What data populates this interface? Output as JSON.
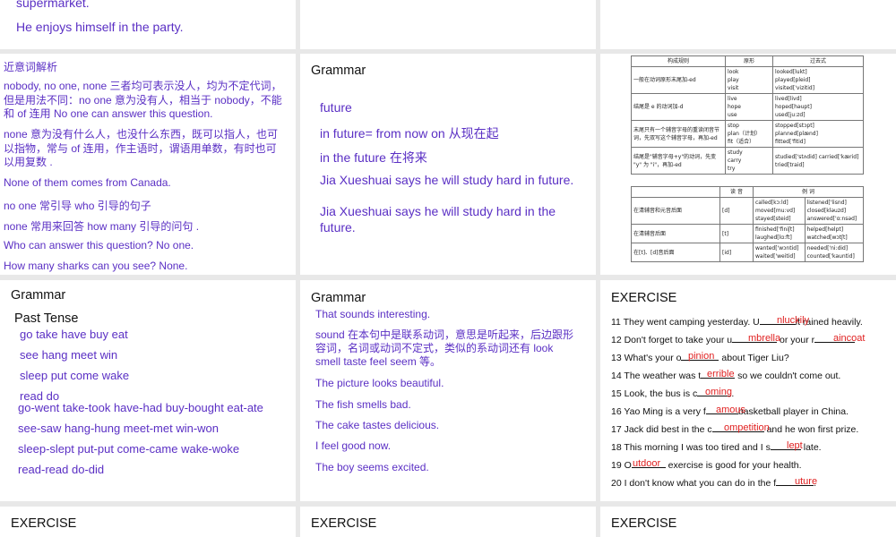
{
  "slide_top_left": {
    "line1": "supermarket.",
    "line2": "He enjoys himself in the party."
  },
  "synonyms": {
    "title": "近意词解析",
    "p1": "nobody, no one, none 三者均可表示没人，均为不定代词，但是用法不同：no one 意为没有人，相当于 nobody，不能和 of 连用   No  one can answer this question.",
    "p2": "none 意为没有什么人，也没什么东西，既可以指人，也可以指物，常与 of 连用，作主语时，谓语用单数，有时也可以用复数 .",
    "ex1": "None of them comes from Canada.",
    "ex2": "no one  常引导 who 引导的句子",
    "ex3": "none 常用来回答 how many 引导的问句 .",
    "ex4": "Who can answer this question? No one.",
    "ex5": "How many sharks can you see? None."
  },
  "grammar_future": {
    "title": "Grammar",
    "l1": "future",
    "l2": "in future= from now on  从现在起",
    "l3": "in the future  在将来",
    "l4": "Jia Xueshuai says he will study hard in future.",
    "l5": "Jia Xueshuai says he will study hard in the future."
  },
  "past_table": {
    "h1": "构成规则",
    "h2": "原形",
    "h3": "过去式",
    "r1": {
      "rule": "一般在动词原形末尾加-ed",
      "base": [
        "look",
        "play",
        "visit"
      ],
      "past": [
        "looked[lukt]",
        "played[pleid]",
        "visited['vizitid]"
      ]
    },
    "r2": {
      "rule": "结尾是 e 的动词加-d",
      "base": [
        "live",
        "hope",
        "use"
      ],
      "past": [
        "lived[livd]",
        "hoped[həupt]",
        "used[ju:zd]"
      ]
    },
    "r3": {
      "rule": "末尾只有一个辅音字母的重读闭音节词，先双写这个辅音字母，再加-ed",
      "base": [
        "stop",
        "plan（计划）",
        "fit（适合）"
      ],
      "past": [
        "stopped[stɔpt]",
        "planned[plænd]",
        "fitted['fitid]"
      ]
    },
    "r4": {
      "rule": "结尾是\"辅音字母+y\"的动词，先变 \"y\" 为 \"i\"，再加-ed",
      "base": [
        "study",
        "carry",
        "try"
      ],
      "past": [
        "studied['stʌdid]   carried['kærid]",
        "tried[traid]",
        ""
      ]
    },
    "p_h1": "读  音",
    "p_h2": "例  词",
    "p1": {
      "rule": "在清辅音和元音后面",
      "sound": "[d]",
      "ex": [
        "called[kɔ:ld]",
        "moved[mu:vd]",
        "stayed[steid]"
      ],
      "ex2": [
        "listened['lisnd]",
        "closed[kləuzd]",
        "answered['ɑ:nsəd]"
      ]
    },
    "p2": {
      "rule": "在清辅音后面",
      "sound": "[t]",
      "ex": [
        "finished['finiʃt]",
        "laughed[lɑ:ft]"
      ],
      "ex2": [
        "helped[helpt]",
        "watched[wɔtʃt]"
      ]
    },
    "p3": {
      "rule": "在[t]、[d]音后面",
      "sound": "[id]",
      "ex": [
        "wanted['wɔntid]",
        "waited['weitid]"
      ],
      "ex2": [
        "needed['ni:did]",
        "counted['kauntid]"
      ]
    }
  },
  "grammar_past": {
    "title": "Grammar",
    "subtitle": "Past Tense",
    "row1": "go   take  have  buy  eat",
    "row2": "see   hang  meet  win",
    "row3": "sleep  put  come  wake",
    "row4": "read  do",
    "row5": "go-went  take-took have-had buy-bought eat-ate",
    "row6": "see-saw  hang-hung meet-met win-won",
    "row7": "sleep-slept put-put come-came wake-woke",
    "row8": "read-read do-did"
  },
  "grammar_link": {
    "title": "Grammar",
    "l1": "That sounds interesting.",
    "l2": "sound 在本句中是联系动词，意思是听起来，后边跟形容词，名词或动词不定式，类似的系动词还有 look smell taste feel seem 等。",
    "l3": "The picture looks beautiful.",
    "l4": "The fish smells bad.",
    "l5": "The cake tastes delicious.",
    "l6": "I feel good now.",
    "l7": "The boy seems excited."
  },
  "exercise": {
    "title": "EXERCISE",
    "items": [
      {
        "pre": "11 They went camping yesterday. U",
        "ans": "nluckily",
        "post": "it rained heavily."
      },
      {
        "pre": "12 Don't forget to take your u",
        "ans": "mbrella",
        "post": " or your r",
        "ans2": "aincoat"
      },
      {
        "pre": "13 What's your o",
        "ans": "pinion",
        "post": " about Tiger Liu?"
      },
      {
        "pre": "14 The weather was t",
        "ans": "errible",
        "post": " so we couldn't come out."
      },
      {
        "pre": "15 Look, the bus is c",
        "ans": "oming",
        "post": "."
      },
      {
        "pre": "16 Yao Ming is a very f",
        "ans": "amous",
        "post": "basketball player in China."
      },
      {
        "pre": "17 Jack did best in the c",
        "ans": "ompetition",
        "post": " and he won first prize."
      },
      {
        "pre": "18 This morning I was too tired and I s",
        "ans": "lept",
        "post": " late."
      },
      {
        "pre": "19 O",
        "ans": "utdoor",
        "post": " exercise is good for your health."
      },
      {
        "pre": "20 I don't know what you can do in the f",
        "ans": "uture",
        "post": "."
      }
    ]
  },
  "bottom_titles": {
    "a": "EXERCISE",
    "b": "EXERCISE",
    "c": "EXERCISE"
  }
}
